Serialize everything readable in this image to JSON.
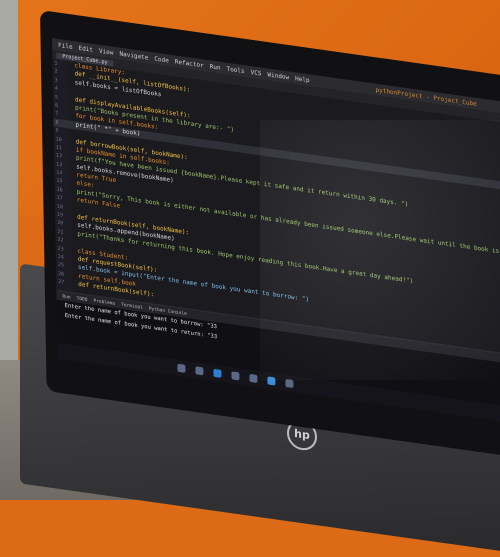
{
  "window": {
    "menu": [
      "File",
      "Edit",
      "View",
      "Navigate",
      "Code",
      "Refactor",
      "Run",
      "Tools",
      "VCS",
      "Window",
      "Help"
    ],
    "title": "pythonProject - Project_Cube",
    "tab": "Project_Cube.py"
  },
  "code_lines": [
    {
      "n": "1",
      "text": "class Library:",
      "cls": "k"
    },
    {
      "n": "2",
      "text": "    def __init__(self, listOfBooks):",
      "cls": "f"
    },
    {
      "n": "3",
      "text": "        self.books = listOfBooks",
      "cls": ""
    },
    {
      "n": "4",
      "text": "",
      "cls": ""
    },
    {
      "n": "5",
      "text": "    def displayAvailableBooks(self):",
      "cls": "f"
    },
    {
      "n": "6",
      "text": "        print(\"Books present in the library are:- \")",
      "cls": "s"
    },
    {
      "n": "7",
      "text": "        for book in self.books:",
      "cls": "k"
    },
    {
      "n": "8",
      "text": "            print(\" *\" + book)",
      "cls": ""
    },
    {
      "n": "9",
      "text": "",
      "cls": ""
    },
    {
      "n": "10",
      "text": "    def borrowBook(self, bookName):",
      "cls": "f"
    },
    {
      "n": "11",
      "text": "        if bookName in self.books:",
      "cls": "k"
    },
    {
      "n": "12",
      "text": "            print(f\"You have been issued {bookName}.Please kept it safe and it return within 30 days. \")",
      "cls": "s"
    },
    {
      "n": "13",
      "text": "            self.books.remove(bookName)",
      "cls": ""
    },
    {
      "n": "14",
      "text": "            return True",
      "cls": "k"
    },
    {
      "n": "15",
      "text": "        else:",
      "cls": "k"
    },
    {
      "n": "16",
      "text": "            print(\"Sorry, This book is either not available or has already been issued someone else.Please wait until the book is available\")",
      "cls": "s"
    },
    {
      "n": "17",
      "text": "            return False",
      "cls": "k"
    },
    {
      "n": "18",
      "text": "",
      "cls": ""
    },
    {
      "n": "19",
      "text": "    def returnBook(self, bookName):",
      "cls": "f"
    },
    {
      "n": "20",
      "text": "        self.books.append(bookName)",
      "cls": ""
    },
    {
      "n": "21",
      "text": "        print(\"Thanks for returning this book. Hope enjoy reading this book.Have a great day ahead!\")",
      "cls": "s"
    },
    {
      "n": "22",
      "text": "",
      "cls": ""
    },
    {
      "n": "23",
      "text": "class Student:",
      "cls": "k"
    },
    {
      "n": "24",
      "text": "    def requestBook(self):",
      "cls": "f"
    },
    {
      "n": "25",
      "text": "        self.book = input(\"Enter the name of book you want to borrow: \")",
      "cls": "c"
    },
    {
      "n": "26",
      "text": "        return self.book",
      "cls": "k"
    },
    {
      "n": "27",
      "text": "    def returnBook(self):",
      "cls": "f"
    }
  ],
  "terminal": {
    "tabs": [
      "Run",
      "TODO",
      "Problems",
      "Terminal",
      "Python Console"
    ],
    "lines": [
      "Enter the name of book you want to borrow: \"33",
      "Enter the name of book you want to return: \"33"
    ]
  },
  "brand": {
    "logo": "hp"
  }
}
